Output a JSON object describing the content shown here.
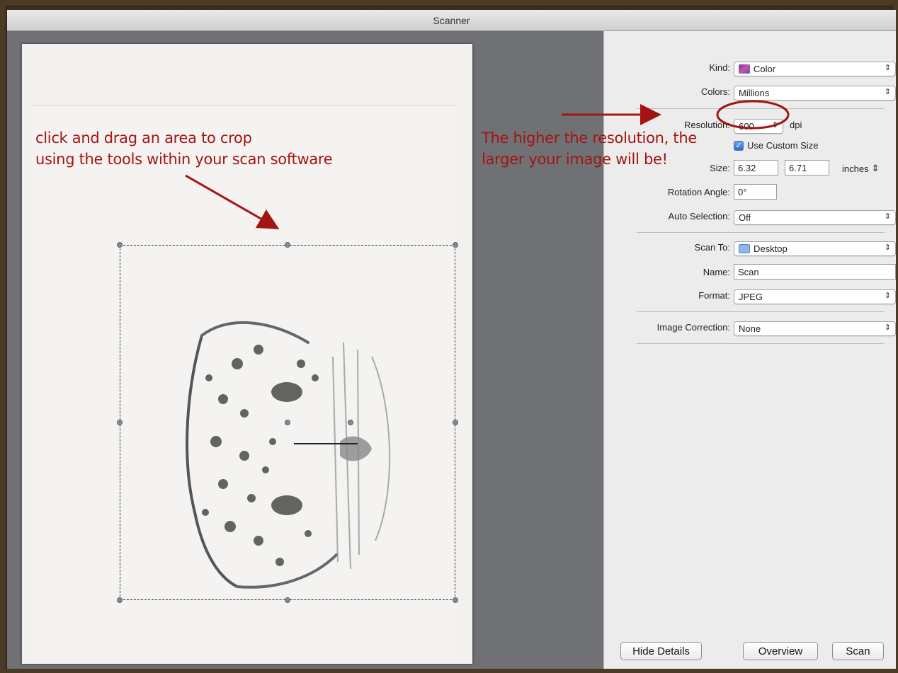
{
  "window": {
    "title": "Scanner"
  },
  "annotations": {
    "crop_line1": "click and drag an area to crop",
    "crop_line2": "using the tools within your scan software",
    "resolution_line1": "The higher the resolution, the",
    "resolution_line2": "larger your image will be!",
    "color": "#a31512"
  },
  "settings": {
    "kind_label": "Kind:",
    "kind_value": "Color",
    "colors_label": "Colors:",
    "colors_value": "Millions",
    "resolution_label": "Resolution:",
    "resolution_value": "600",
    "resolution_unit": "dpi",
    "custom_size_label": "Use Custom Size",
    "custom_size_checked": true,
    "size_label": "Size:",
    "size_width": "6.32",
    "size_height": "6.71",
    "size_unit": "inches",
    "rotation_label": "Rotation Angle:",
    "rotation_value": "0°",
    "auto_selection_label": "Auto Selection:",
    "auto_selection_value": "Off",
    "scan_to_label": "Scan To:",
    "scan_to_value": "Desktop",
    "name_label": "Name:",
    "name_value": "Scan",
    "format_label": "Format:",
    "format_value": "JPEG",
    "image_correction_label": "Image Correction:",
    "image_correction_value": "None"
  },
  "buttons": {
    "hide_details": "Hide Details",
    "overview": "Overview",
    "scan": "Scan"
  },
  "icons": {
    "kind": "color-swatch-icon",
    "scan_to": "folder-icon",
    "popup": "updown-arrows-icon"
  }
}
